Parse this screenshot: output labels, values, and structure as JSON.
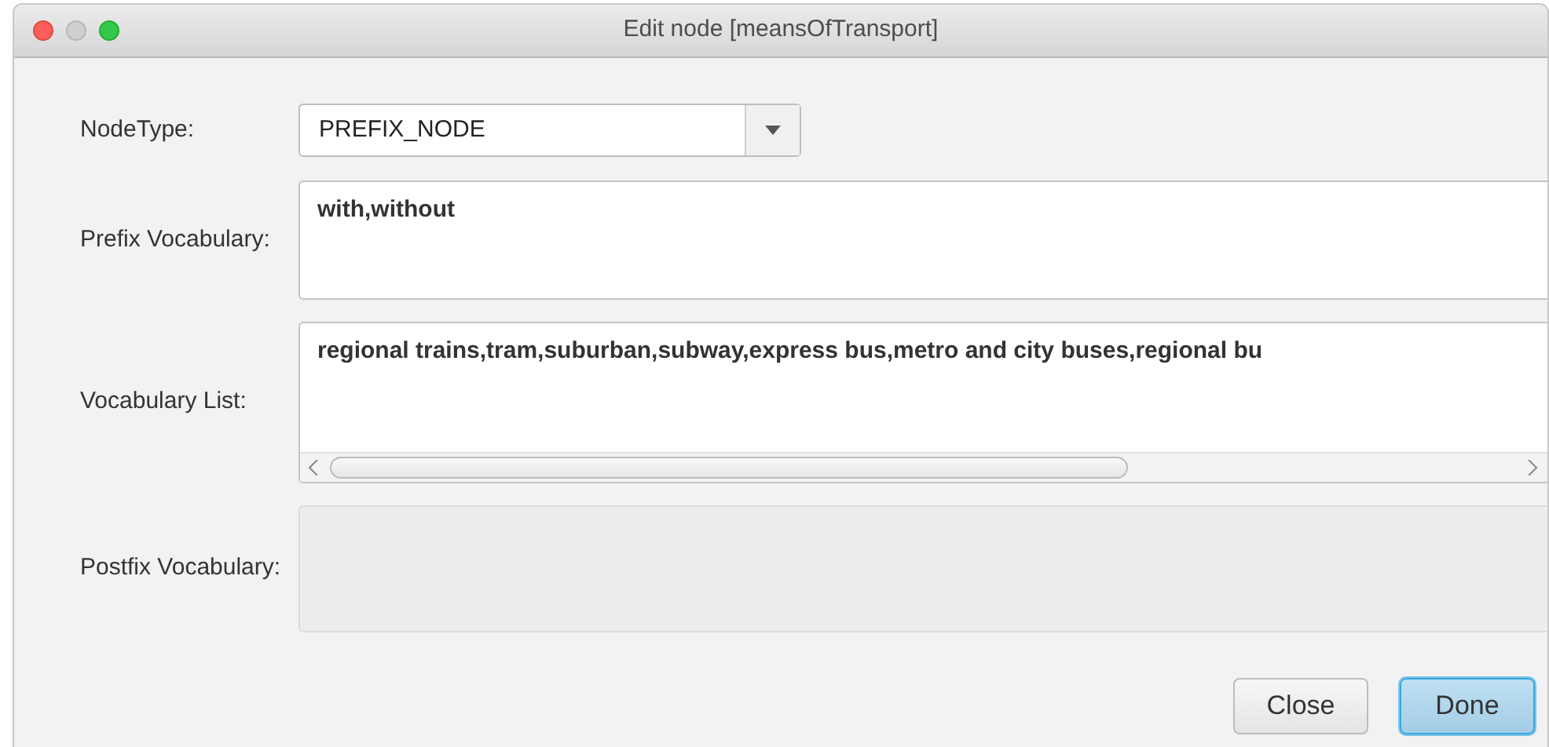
{
  "window": {
    "title": "Edit node [meansOfTransport]"
  },
  "node_type": {
    "label": "NodeType:",
    "value": "PREFIX_NODE"
  },
  "fields": [
    {
      "label": "Prefix Vocabulary:",
      "value": "with,without",
      "disabled": false,
      "scrollbar": false
    },
    {
      "label": "Vocabulary List:",
      "value": "regional trains,tram,suburban,subway,express bus,metro and city buses,regional bu",
      "disabled": false,
      "scrollbar": true
    },
    {
      "label": "Postfix Vocabulary:",
      "disabled": true,
      "scrollbar": false
    }
  ],
  "buttons": [
    {
      "label": "Close",
      "default": false
    },
    {
      "label": "Done",
      "default": true
    }
  ]
}
